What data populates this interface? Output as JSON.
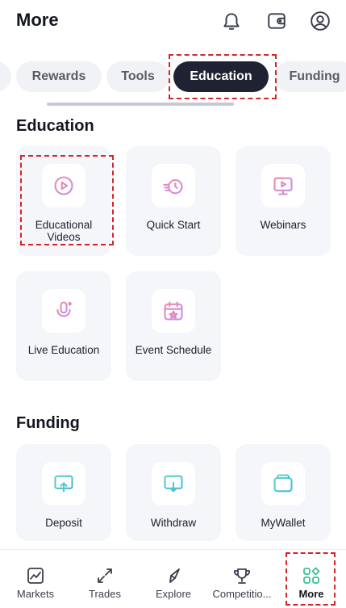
{
  "header": {
    "title": "More",
    "icons": [
      "bell-icon",
      "wallet-icon",
      "user-icon"
    ]
  },
  "tabs": [
    {
      "label": ""
    },
    {
      "label": "Rewards"
    },
    {
      "label": "Tools"
    },
    {
      "label": "Education",
      "active": true
    },
    {
      "label": "Funding"
    }
  ],
  "sections": {
    "education": {
      "title": "Education",
      "items": [
        {
          "label": "Educational Videos",
          "icon": "play-circle-icon"
        },
        {
          "label": "Quick Start",
          "icon": "stopwatch-icon"
        },
        {
          "label": "Webinars",
          "icon": "monitor-play-icon"
        },
        {
          "label": "Live Education",
          "icon": "microphone-icon"
        },
        {
          "label": "Event Schedule",
          "icon": "calendar-star-icon"
        }
      ]
    },
    "funding": {
      "title": "Funding",
      "items": [
        {
          "label": "Deposit",
          "icon": "deposit-icon"
        },
        {
          "label": "Withdraw",
          "icon": "withdraw-icon"
        },
        {
          "label": "MyWallet",
          "icon": "mywallet-icon"
        }
      ]
    }
  },
  "bottom_nav": [
    {
      "label": "Markets",
      "icon": "chart-icon"
    },
    {
      "label": "Trades",
      "icon": "trades-arrows-icon"
    },
    {
      "label": "Explore",
      "icon": "compass-icon"
    },
    {
      "label": "Competitio...",
      "icon": "trophy-icon"
    },
    {
      "label": "More",
      "icon": "grid-more-icon",
      "active": true
    }
  ],
  "colors": {
    "accent_dark": "#1e2233",
    "education_icon_gradient": [
      "#f08aa0",
      "#c68cf0"
    ],
    "funding_icon_color": "#4ecdb4",
    "more_icon_color": "#3fbf8f",
    "highlight": "#d3262b"
  }
}
